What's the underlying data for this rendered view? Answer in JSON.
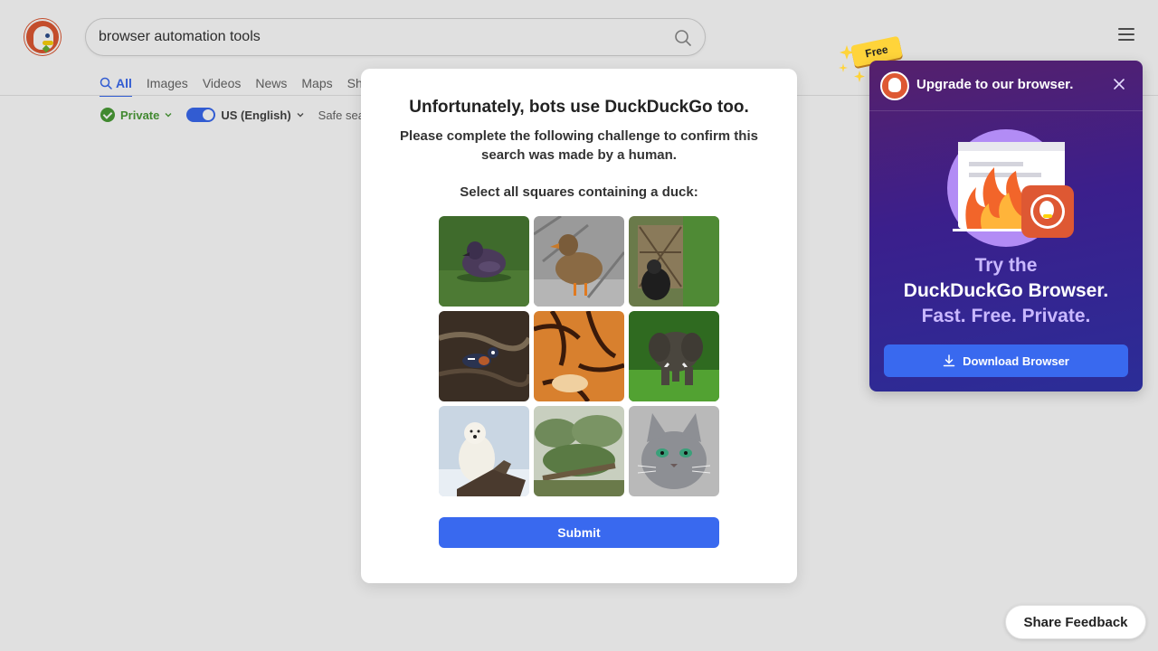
{
  "search": {
    "query": "browser automation tools"
  },
  "tabs": [
    {
      "label": "All",
      "active": true
    },
    {
      "label": "Images"
    },
    {
      "label": "Videos"
    },
    {
      "label": "News"
    },
    {
      "label": "Maps"
    },
    {
      "label": "Sho"
    }
  ],
  "filters": {
    "private_label": "Private",
    "region_label": "US (English)",
    "safe_search_label": "Safe sea"
  },
  "captcha": {
    "title": "Unfortunately, bots use DuckDuckGo too.",
    "subtitle": "Please complete the following challenge to confirm this search was made by a human.",
    "instruction": "Select all squares containing a duck:",
    "submit_label": "Submit",
    "tiles": [
      {
        "name": "duck-swimming-tile",
        "theme": "duck-water"
      },
      {
        "name": "mallard-duck-grayscale-tile",
        "theme": "duck-gray"
      },
      {
        "name": "gorilla-in-enclosure-tile",
        "theme": "gorilla"
      },
      {
        "name": "harlequin-duck-river-tile",
        "theme": "duck-river"
      },
      {
        "name": "tiger-fur-tile",
        "theme": "tiger"
      },
      {
        "name": "elephant-on-grass-tile",
        "theme": "elephant"
      },
      {
        "name": "polar-bear-tile",
        "theme": "polar-bear"
      },
      {
        "name": "shrubs-landscape-tile",
        "theme": "shrubs"
      },
      {
        "name": "gray-cat-tile",
        "theme": "cat"
      }
    ]
  },
  "promo": {
    "badge": "Free",
    "headline": "Upgrade to our browser.",
    "line1": "Try the",
    "line2": "DuckDuckGo Browser.",
    "line3": "Fast. Free. Private.",
    "download_label": "Download Browser"
  },
  "feedback": {
    "label": "Share Feedback"
  },
  "colors": {
    "accent": "#3969ef",
    "private_green": "#4a9c37",
    "brand_orange": "#de5833"
  }
}
